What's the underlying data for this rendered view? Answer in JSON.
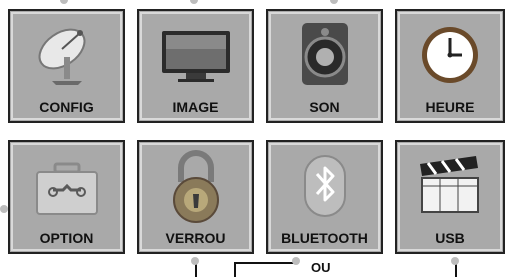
{
  "menu": {
    "tiles": [
      {
        "label": "CONFIG",
        "icon": "satellite-dish-icon"
      },
      {
        "label": "IMAGE",
        "icon": "tv-monitor-icon"
      },
      {
        "label": "SON",
        "icon": "speaker-icon"
      },
      {
        "label": "HEURE",
        "icon": "clock-icon"
      },
      {
        "label": "OPTION",
        "icon": "toolbox-icon"
      },
      {
        "label": "VERROU",
        "icon": "padlock-icon"
      },
      {
        "label": "BLUETOOTH",
        "icon": "bluetooth-icon"
      },
      {
        "label": "USB",
        "icon": "clapperboard-icon"
      }
    ]
  },
  "callout": {
    "text": "OU"
  },
  "colors": {
    "tile_bg": "#a9a9a9",
    "tile_border": "#222222",
    "callout_dot": "#bdbdbd"
  }
}
